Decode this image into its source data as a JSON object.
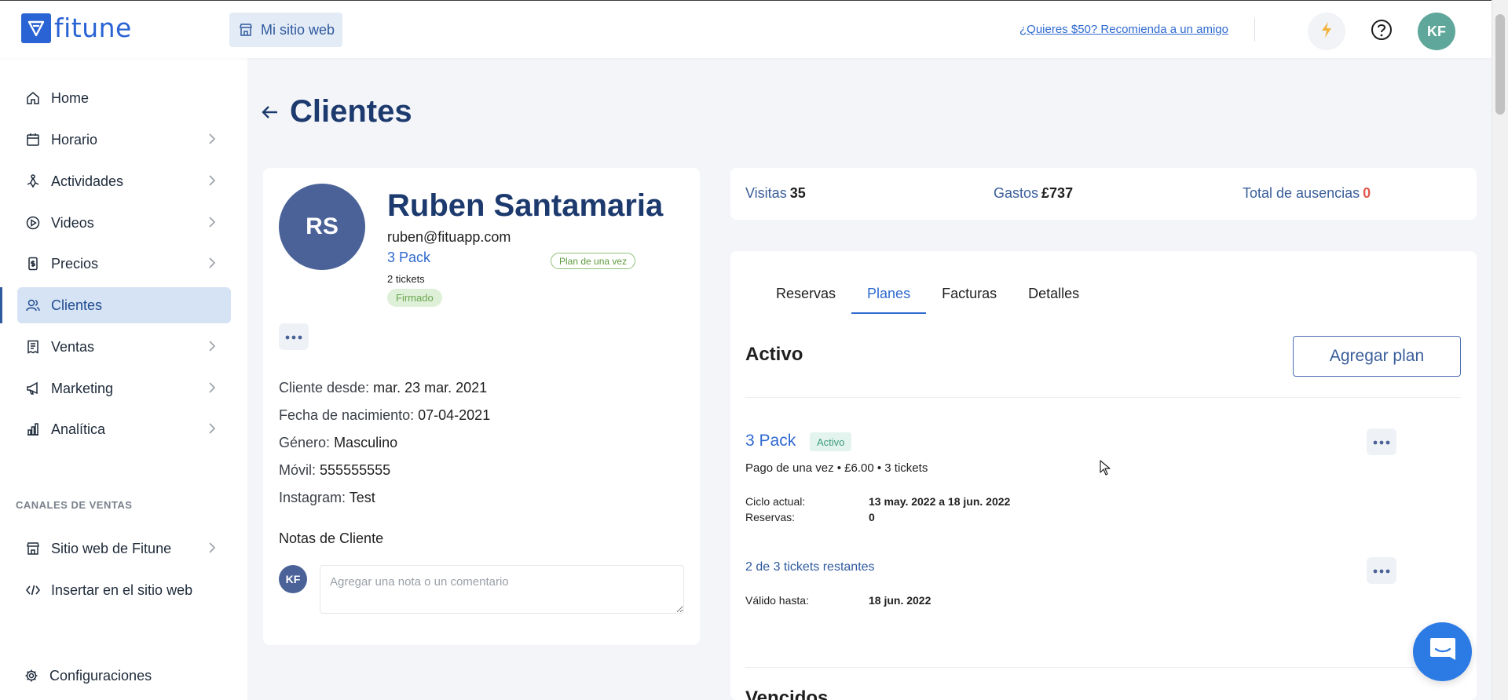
{
  "brand": {
    "name": "fitune",
    "color": "#2a63d4"
  },
  "topbar": {
    "site_button_label": "Mi sitio web",
    "referral_link": "¿Quieres $50? Recomienda a un amigo",
    "user_initials": "KF"
  },
  "sidebar": {
    "items": [
      {
        "label": "Home",
        "icon": "home-icon"
      },
      {
        "label": "Horario",
        "icon": "calendar-icon"
      },
      {
        "label": "Actividades",
        "icon": "activity-icon"
      },
      {
        "label": "Videos",
        "icon": "play-icon"
      },
      {
        "label": "Precios",
        "icon": "price-tag-icon"
      },
      {
        "label": "Clientes",
        "icon": "clients-icon",
        "active": true
      },
      {
        "label": "Ventas",
        "icon": "receipt-icon"
      },
      {
        "label": "Marketing",
        "icon": "megaphone-icon"
      },
      {
        "label": "Analítica",
        "icon": "chart-icon"
      }
    ],
    "sales_channels_title": "CANALES DE VENTAS",
    "sales_channels": [
      {
        "label": "Sitio web de Fitune",
        "icon": "store-icon"
      },
      {
        "label": "Insertar en el sitio web",
        "icon": "code-icon"
      }
    ],
    "settings_label": "Configuraciones"
  },
  "page": {
    "title": "Clientes"
  },
  "client": {
    "initials": "RS",
    "name": "Ruben Santamaria",
    "email": "ruben@fituapp.com",
    "plan": "3 Pack",
    "plan_tag": "Plan de una vez",
    "tickets": "2 tickets",
    "signed_badge": "Firmado",
    "details": [
      {
        "label": "Cliente desde:",
        "value": "mar. 23 mar. 2021"
      },
      {
        "label": "Fecha de nacimiento:",
        "value": "07-04-2021"
      },
      {
        "label": "Género:",
        "value": "Masculino"
      },
      {
        "label": "Móvil:",
        "value": "555555555"
      },
      {
        "label": "Instagram:",
        "value": "Test"
      }
    ],
    "notes_title": "Notas de Cliente",
    "note_author_initials": "KF",
    "note_placeholder": "Agregar una nota o un comentario"
  },
  "stats": {
    "visits_label": "Visitas",
    "visits": "35",
    "spend_label": "Gastos",
    "spend": "£737",
    "absences_label": "Total de ausencias",
    "absences": "0"
  },
  "tabs": [
    "Reservas",
    "Planes",
    "Facturas",
    "Detalles"
  ],
  "active_tab": "Planes",
  "plans": {
    "active_title": "Activo",
    "add_button": "Agregar plan",
    "plan_name": "3 Pack",
    "status_badge": "Activo",
    "meta": "Pago de una vez • £6.00 • 3 tickets",
    "cycle_label": "Ciclo actual:",
    "cycle_value": "13 may. 2022 a 18 jun. 2022",
    "bookings_label": "Reservas:",
    "bookings_value": "0",
    "tickets_left": "2 de 3 tickets restantes",
    "valid_label": "Válido hasta:",
    "valid_value": "18 jun. 2022",
    "expired_title": "Vencidos"
  }
}
